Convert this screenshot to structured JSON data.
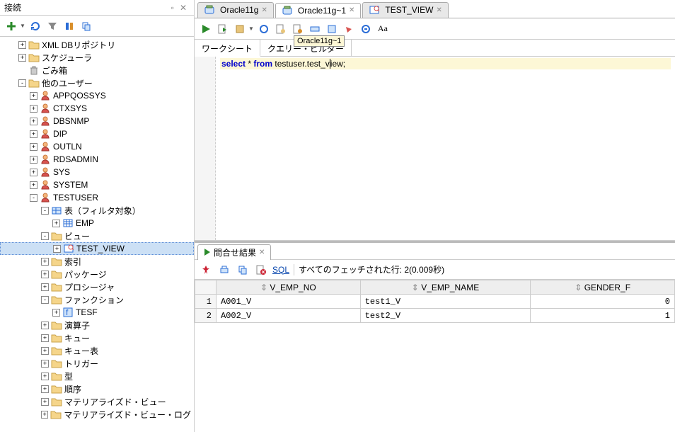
{
  "panel": {
    "title": "接続"
  },
  "tree": {
    "nodes": [
      {
        "depth": 1,
        "expander": "+",
        "icon": "folder-xml",
        "label": "XML DBリポジトリ"
      },
      {
        "depth": 1,
        "expander": "+",
        "icon": "folder",
        "label": "スケジューラ"
      },
      {
        "depth": 1,
        "expander": "",
        "icon": "trash",
        "label": "ごみ箱"
      },
      {
        "depth": 1,
        "expander": "-",
        "icon": "folder",
        "label": "他のユーザー"
      },
      {
        "depth": 2,
        "expander": "+",
        "icon": "user",
        "label": "APPQOSSYS"
      },
      {
        "depth": 2,
        "expander": "+",
        "icon": "user",
        "label": "CTXSYS"
      },
      {
        "depth": 2,
        "expander": "+",
        "icon": "user",
        "label": "DBSNMP"
      },
      {
        "depth": 2,
        "expander": "+",
        "icon": "user",
        "label": "DIP"
      },
      {
        "depth": 2,
        "expander": "+",
        "icon": "user",
        "label": "OUTLN"
      },
      {
        "depth": 2,
        "expander": "+",
        "icon": "user",
        "label": "RDSADMIN"
      },
      {
        "depth": 2,
        "expander": "+",
        "icon": "user",
        "label": "SYS"
      },
      {
        "depth": 2,
        "expander": "+",
        "icon": "user",
        "label": "SYSTEM"
      },
      {
        "depth": 2,
        "expander": "-",
        "icon": "user",
        "label": "TESTUSER"
      },
      {
        "depth": 3,
        "expander": "-",
        "icon": "table-folder",
        "label": "表（フィルタ対象）"
      },
      {
        "depth": 4,
        "expander": "+",
        "icon": "table",
        "label": "EMP"
      },
      {
        "depth": 3,
        "expander": "-",
        "icon": "folder",
        "label": "ビュー"
      },
      {
        "depth": 4,
        "expander": "+",
        "icon": "view",
        "label": "TEST_VIEW",
        "selected": true
      },
      {
        "depth": 3,
        "expander": "+",
        "icon": "folder",
        "label": "索引"
      },
      {
        "depth": 3,
        "expander": "+",
        "icon": "folder",
        "label": "パッケージ"
      },
      {
        "depth": 3,
        "expander": "+",
        "icon": "folder",
        "label": "プロシージャ"
      },
      {
        "depth": 3,
        "expander": "-",
        "icon": "folder",
        "label": "ファンクション"
      },
      {
        "depth": 4,
        "expander": "+",
        "icon": "func",
        "label": "TESF"
      },
      {
        "depth": 3,
        "expander": "+",
        "icon": "folder",
        "label": "演算子"
      },
      {
        "depth": 3,
        "expander": "+",
        "icon": "folder",
        "label": "キュー"
      },
      {
        "depth": 3,
        "expander": "+",
        "icon": "folder",
        "label": "キュー表"
      },
      {
        "depth": 3,
        "expander": "+",
        "icon": "folder",
        "label": "トリガー"
      },
      {
        "depth": 3,
        "expander": "+",
        "icon": "folder",
        "label": "型"
      },
      {
        "depth": 3,
        "expander": "+",
        "icon": "folder",
        "label": "順序"
      },
      {
        "depth": 3,
        "expander": "+",
        "icon": "folder",
        "label": "マテリアライズド・ビュー"
      },
      {
        "depth": 3,
        "expander": "+",
        "icon": "folder",
        "label": "マテリアライズド・ビュー・ログ"
      }
    ]
  },
  "tabs": [
    {
      "label": "Oracle11g",
      "icon": "sql"
    },
    {
      "label": "Oracle11g~1",
      "icon": "sql",
      "active": true
    },
    {
      "label": "TEST_VIEW",
      "icon": "view"
    }
  ],
  "tooltip": "Oracle11g~1",
  "subtabs": {
    "worksheet": "ワークシート",
    "querybuilder": "クエリー・ビルダー"
  },
  "sql": {
    "kw1": "select",
    "star": "*",
    "kw2": "from",
    "ident": "testuser.test_v",
    "rest": "iew;"
  },
  "results": {
    "tab": "問合せ結果",
    "sql_link": "SQL",
    "status": "すべてのフェッチされた行: 2(0.009秒)",
    "cols": [
      "V_EMP_NO",
      "V_EMP_NAME",
      "GENDER_F"
    ],
    "rows": [
      {
        "n": "1",
        "c": [
          "A001_V",
          "test1_V",
          "0"
        ]
      },
      {
        "n": "2",
        "c": [
          "A002_V",
          "test2_V",
          "1"
        ]
      }
    ]
  }
}
